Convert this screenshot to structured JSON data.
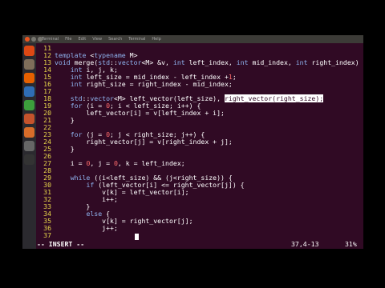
{
  "window": {
    "menu_items": [
      "Terminal",
      "File",
      "Edit",
      "View",
      "Search",
      "Terminal",
      "Help"
    ]
  },
  "launcher": {
    "icons": [
      {
        "name": "ubuntu-icon",
        "color": "#dd4814"
      },
      {
        "name": "files-icon",
        "color": "#7f6e5a"
      },
      {
        "name": "firefox-icon",
        "color": "#e66000"
      },
      {
        "name": "writer-icon",
        "color": "#2f6db5"
      },
      {
        "name": "calc-icon",
        "color": "#3c9f3c"
      },
      {
        "name": "impress-icon",
        "color": "#c5532c"
      },
      {
        "name": "software-icon",
        "color": "#d86d2a"
      },
      {
        "name": "settings-icon",
        "color": "#666666"
      },
      {
        "name": "terminal-icon",
        "color": "#333333"
      }
    ]
  },
  "editor": {
    "lines": [
      {
        "n": "11",
        "text": ""
      },
      {
        "n": "12",
        "text": "template <typename M>"
      },
      {
        "n": "13",
        "text": "void merge(std::vector<M> &v, int left_index, int mid_index, int right_index) {"
      },
      {
        "n": "14",
        "text": "    int i, j, k;"
      },
      {
        "n": "15",
        "text": "    int left_size = mid_index - left_index +1;"
      },
      {
        "n": "16",
        "text": "    int right_size = right_index - mid_index;"
      },
      {
        "n": "17",
        "text": ""
      },
      {
        "n": "18",
        "text": "    std::vector<M> left_vector(left_size), ",
        "highlight": "right_vector(right_size);"
      },
      {
        "n": "19",
        "text": "    for (i = 0; i < left_size; i++) {"
      },
      {
        "n": "20",
        "text": "        left_vector[i] = v[left_index + i];"
      },
      {
        "n": "21",
        "text": "    }"
      },
      {
        "n": "22",
        "text": ""
      },
      {
        "n": "23",
        "text": "    for (j = 0; j < right_size; j++) {"
      },
      {
        "n": "24",
        "text": "        right_vector[j] = v[right_index + j];"
      },
      {
        "n": "25",
        "text": "    }"
      },
      {
        "n": "26",
        "text": ""
      },
      {
        "n": "27",
        "text": "    i = 0, j = 0, k = left_index;"
      },
      {
        "n": "28",
        "text": ""
      },
      {
        "n": "29",
        "text": "    while ((i<left_size) && (j<right_size)) {"
      },
      {
        "n": "30",
        "text": "        if (left_vector[i] <= right_vector[j]) {"
      },
      {
        "n": "31",
        "text": "            v[k] = left_vector[i];"
      },
      {
        "n": "32",
        "text": "            i++;"
      },
      {
        "n": "33",
        "text": "        }"
      },
      {
        "n": "34",
        "text": "        else {"
      },
      {
        "n": "35",
        "text": "            v[k] = right_vector[j];"
      },
      {
        "n": "36",
        "text": "            j++;"
      },
      {
        "n": "37",
        "text": ""
      }
    ]
  },
  "status": {
    "mode": "-- INSERT --",
    "position": "37,4-13",
    "percent": "31%"
  }
}
